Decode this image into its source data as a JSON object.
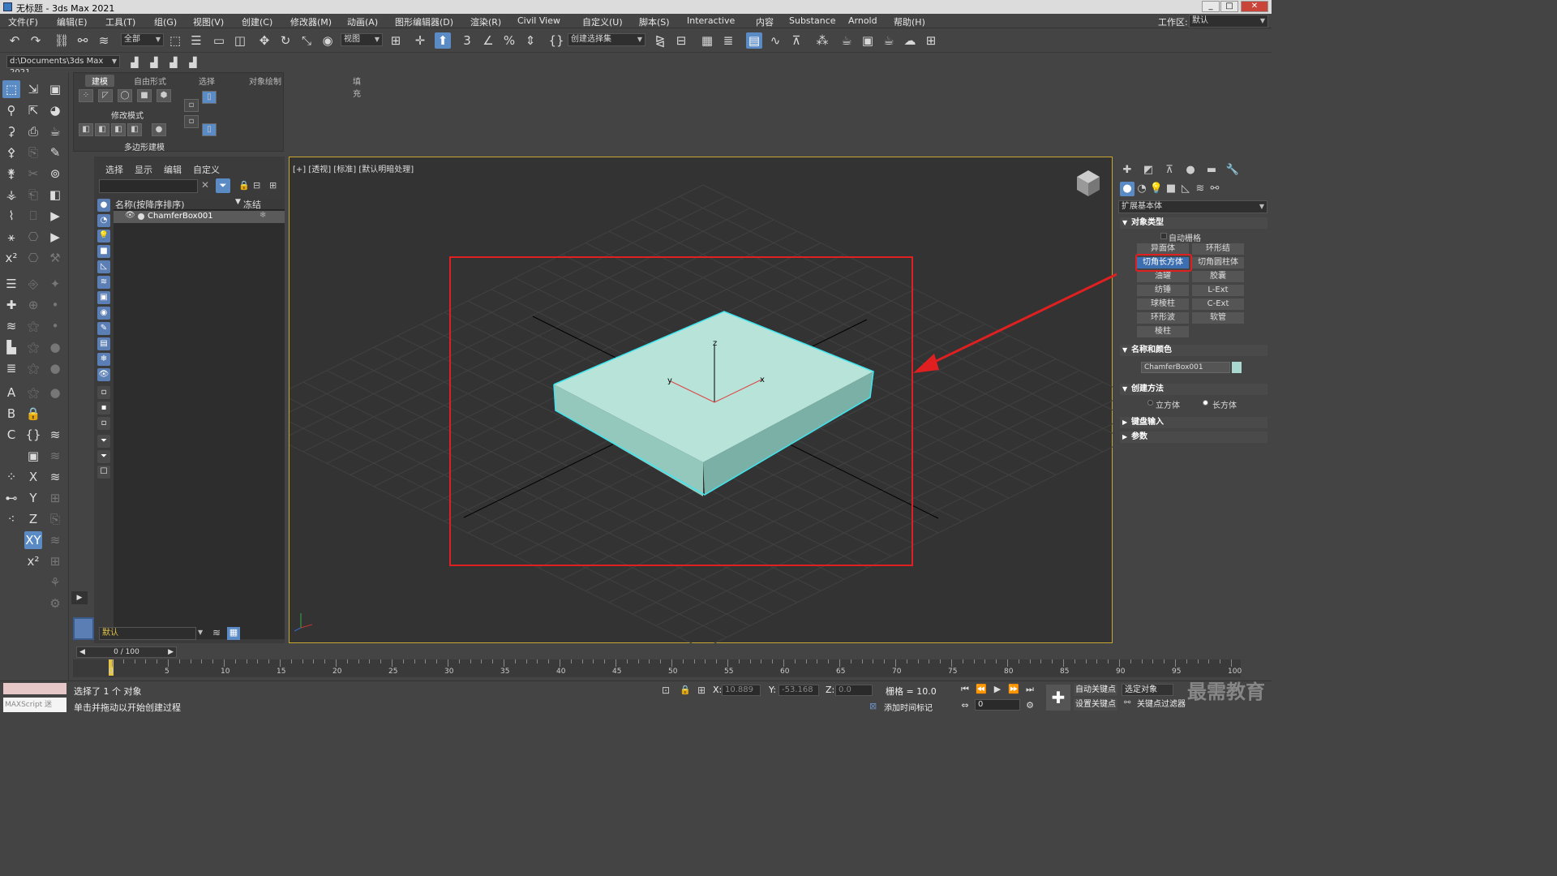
{
  "title": "无标题 - 3ds Max 2021",
  "window_buttons": [
    "_",
    "□",
    "✕"
  ],
  "workspace": {
    "label": "工作区:",
    "value": "默认"
  },
  "menu": [
    "文件(F)",
    "编辑(E)",
    "工具(T)",
    "组(G)",
    "视图(V)",
    "创建(C)",
    "修改器(M)",
    "动画(A)",
    "图形编辑器(D)",
    "渲染(R)",
    "Civil View",
    "自定义(U)",
    "脚本(S)",
    "Interactive",
    "内容",
    "Substance",
    "Arnold",
    "帮助(H)"
  ],
  "toolbar": {
    "filter_select": "全部",
    "ref_coord": "视图",
    "named_selection": "创建选择集",
    "path": "d:\\Documents\\3ds Max 2021"
  },
  "ribbon": {
    "tabs": [
      "建模",
      "自由形式",
      "选择",
      "对象绘制",
      "填充"
    ],
    "modify_mode": "修改模式",
    "poly_modeling": "多边形建模"
  },
  "scene_explorer": {
    "tabs": [
      "选择",
      "显示",
      "编辑",
      "自定义"
    ],
    "col_name": "名称(按降序排序)",
    "col_freeze": "冻结",
    "object": "ChamferBox001",
    "layer": "默认"
  },
  "viewport": {
    "label": "[+] [透视] [标准] [默认明暗处理]",
    "axis_x": "x",
    "axis_y": "y",
    "axis_z": "z",
    "object_color": "#a8d8cf",
    "selection_color": "#3fe6ef",
    "highlight_color": "#e02020"
  },
  "command_panel": {
    "category": "扩展基本体",
    "object_type": {
      "header": "对象类型",
      "autogrid": "自动栅格",
      "buttons": [
        "异面体",
        "环形结",
        "切角长方体",
        "切角圆柱体",
        "油罐",
        "胶囊",
        "纺锤",
        "L-Ext",
        "球棱柱",
        "C-Ext",
        "环形波",
        "软管",
        "棱柱"
      ],
      "active": "切角长方体"
    },
    "name_color": {
      "header": "名称和颜色",
      "name": "ChamferBox001",
      "swatch": "#a8d8cf"
    },
    "creation_method": {
      "header": "创建方法",
      "opt1": "立方体",
      "opt2": "长方体",
      "selected": "长方体"
    },
    "keyboard": "键盘输入",
    "params": "参数"
  },
  "timeline": {
    "frame": "0 / 100",
    "ticks": [
      "0",
      "5",
      "10",
      "15",
      "20",
      "25",
      "30",
      "35",
      "40",
      "45",
      "50",
      "55",
      "60",
      "65",
      "70",
      "75",
      "80",
      "85",
      "90",
      "95",
      "100"
    ]
  },
  "status": {
    "maxscript": "MAXScript 迷",
    "selected": "选择了 1 个 对象",
    "prompt": "单击并拖动以开始创建过程",
    "x_label": "X:",
    "x_val": "10.889",
    "y_label": "Y:",
    "y_val": "-53.168",
    "z_label": "Z:",
    "z_val": "0.0",
    "grid": "栅格 = 10.0",
    "add_tag": "添加时间标记",
    "auto_key": "自动关键点",
    "set_key": "设置关键点",
    "selected_obj": "选定对象",
    "key_filter": "关键点过滤器",
    "frame_val": "0"
  },
  "watermark": "最需教育"
}
